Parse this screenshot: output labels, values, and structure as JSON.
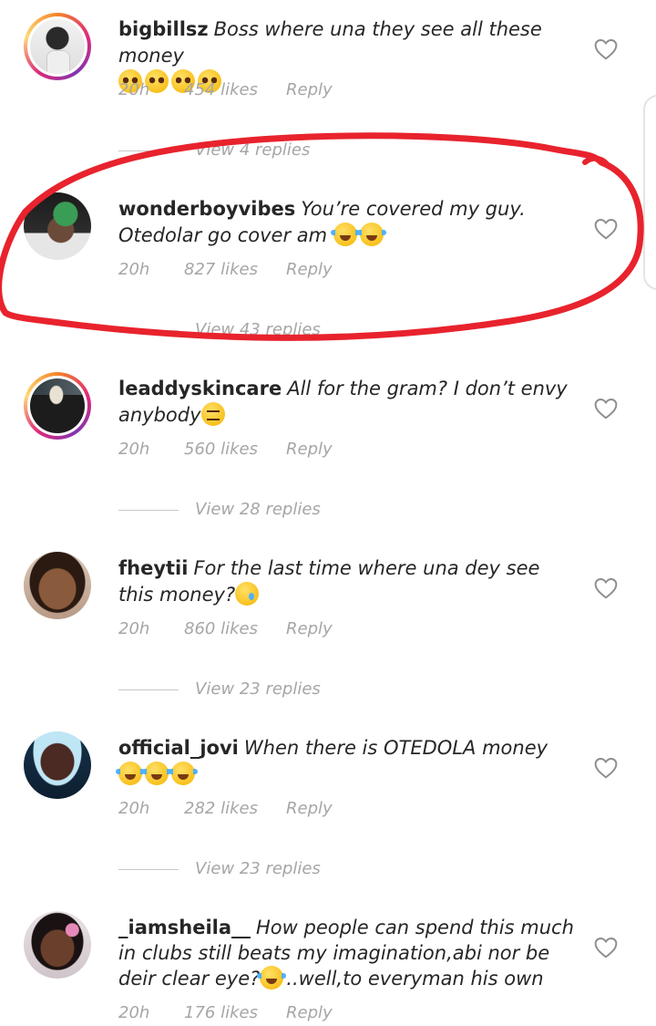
{
  "comments": [
    {
      "username": "bigbillsz",
      "text": "Boss where una they see all these money",
      "emojis": [
        "pleading-face",
        "pleading-face",
        "pleading-face",
        "pleading-face"
      ],
      "time": "20h",
      "likes": "454 likes",
      "reply_label": "Reply",
      "view_replies": "View 4 replies"
    },
    {
      "username": "wonderboyvibes",
      "text": "You’re covered my guy. Otedolar go cover am",
      "emojis": [
        "tears-of-joy",
        "tears-of-joy"
      ],
      "time": "20h",
      "likes": "827 likes",
      "reply_label": "Reply",
      "view_replies": "View 43 replies"
    },
    {
      "username": "leaddyskincare",
      "text": "All for the gram? I don’t envy anybody",
      "emojis": [
        "unamused-face"
      ],
      "time": "20h",
      "likes": "560 likes",
      "reply_label": "Reply",
      "view_replies": "View 28 replies"
    },
    {
      "username": "fheytii",
      "text": "For the last time where una dey see this money?",
      "emojis": [
        "crying-face"
      ],
      "time": "20h",
      "likes": "860 likes",
      "reply_label": "Reply",
      "view_replies": "View 23 replies"
    },
    {
      "username": "official_jovi",
      "text": "When there is OTEDOLA money",
      "emojis": [
        "tears-of-joy",
        "tears-of-joy",
        "tears-of-joy"
      ],
      "time": "20h",
      "likes": "282 likes",
      "reply_label": "Reply",
      "view_replies": "View 23 replies"
    },
    {
      "username": "_iamsheila__",
      "text": "How people can spend this much in clubs still beats my imagination,abi nor be deir clear eye?",
      "emojis": [
        "tears-of-joy"
      ],
      "text_after": "..well,to everyman his own",
      "time": "20h",
      "likes": "176 likes",
      "reply_label": "Reply",
      "view_replies": ""
    }
  ],
  "icons": {
    "like": "heart-outline-icon"
  },
  "colors": {
    "annotation": "#e8232d",
    "meta_text": "#a6a6a6",
    "story_ring": "#dd2a7b"
  }
}
